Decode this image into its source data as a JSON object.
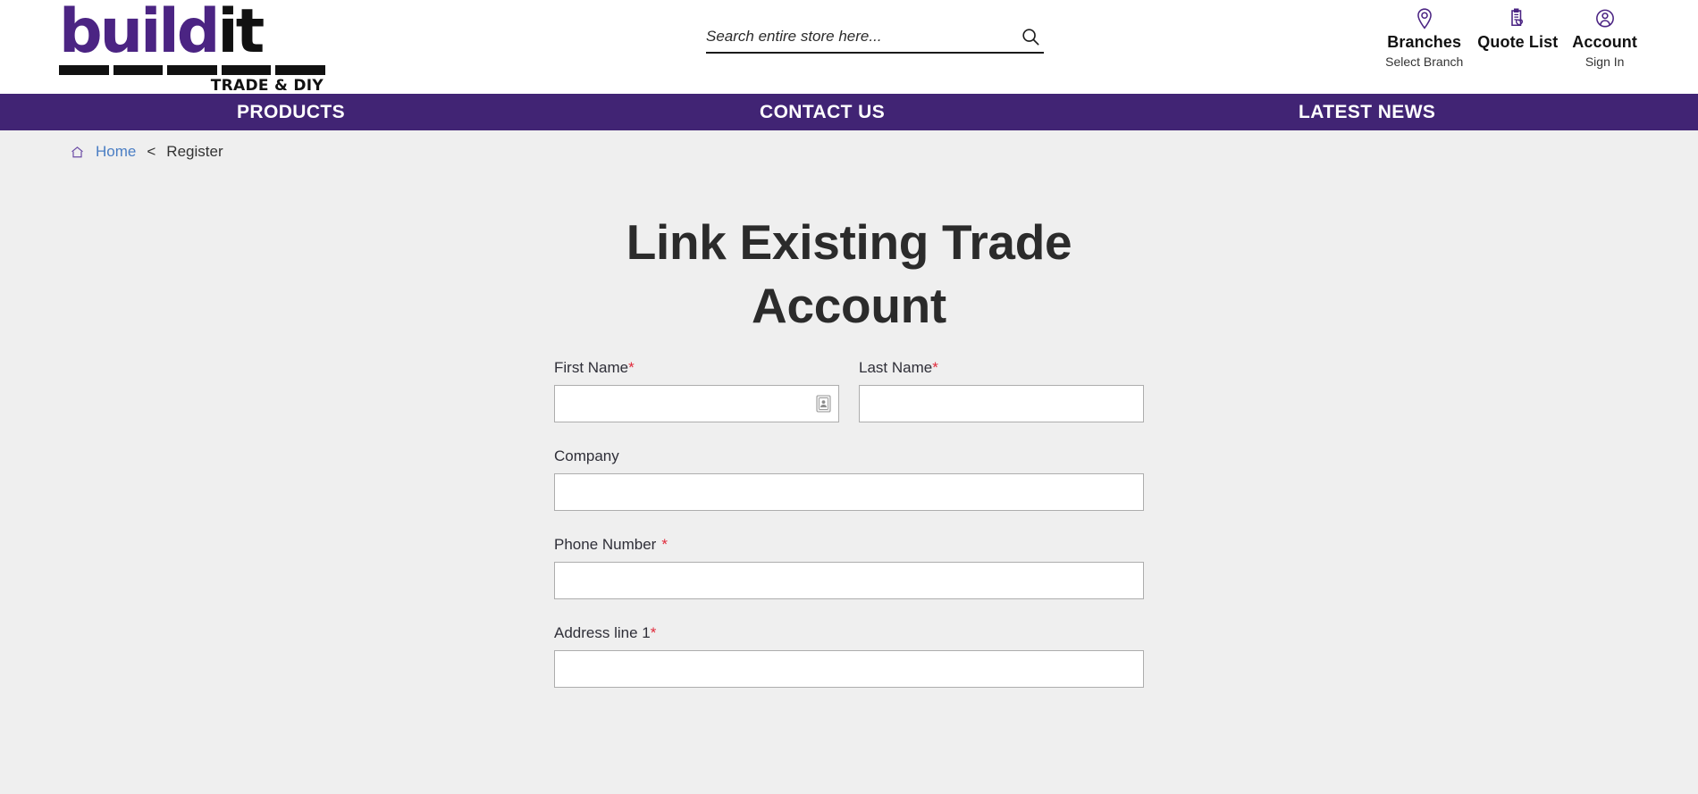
{
  "brand": {
    "name_build": "build",
    "name_it": "it",
    "tagline": "TRADE & DIY",
    "purple": "#412474",
    "logo_purple": "#4b2483"
  },
  "search": {
    "placeholder": "Search entire store here...",
    "value": "",
    "icon": "search-icon"
  },
  "header_links": [
    {
      "icon": "map-pin-icon",
      "title": "Branches",
      "sub": "Select Branch"
    },
    {
      "icon": "clipboard-heart-icon",
      "title": "Quote List",
      "sub": ""
    },
    {
      "icon": "user-circle-icon",
      "title": "Account",
      "sub": "Sign In"
    }
  ],
  "nav": {
    "products": "PRODUCTS",
    "contact": "CONTACT US",
    "news": "LATEST NEWS"
  },
  "breadcrumb": {
    "home_icon": "home-icon",
    "home": "Home",
    "separator": "<",
    "current": "Register"
  },
  "main": {
    "title": "Link Existing Trade Account"
  },
  "form": {
    "fields": [
      {
        "name": "first-name",
        "label": "First Name",
        "required": true,
        "required_spaced": false,
        "value": "",
        "has_autofill_icon": true
      },
      {
        "name": "last-name",
        "label": "Last Name",
        "required": true,
        "required_spaced": false,
        "value": "",
        "has_autofill_icon": false
      },
      {
        "name": "company",
        "label": "Company",
        "required": false,
        "required_spaced": false,
        "value": "",
        "has_autofill_icon": false
      },
      {
        "name": "phone-number",
        "label": "Phone Number",
        "required": true,
        "required_spaced": true,
        "value": "",
        "has_autofill_icon": false
      },
      {
        "name": "address-line-1",
        "label": "Address line 1",
        "required": true,
        "required_spaced": false,
        "value": "",
        "has_autofill_icon": false
      }
    ],
    "required_marker": "*"
  }
}
